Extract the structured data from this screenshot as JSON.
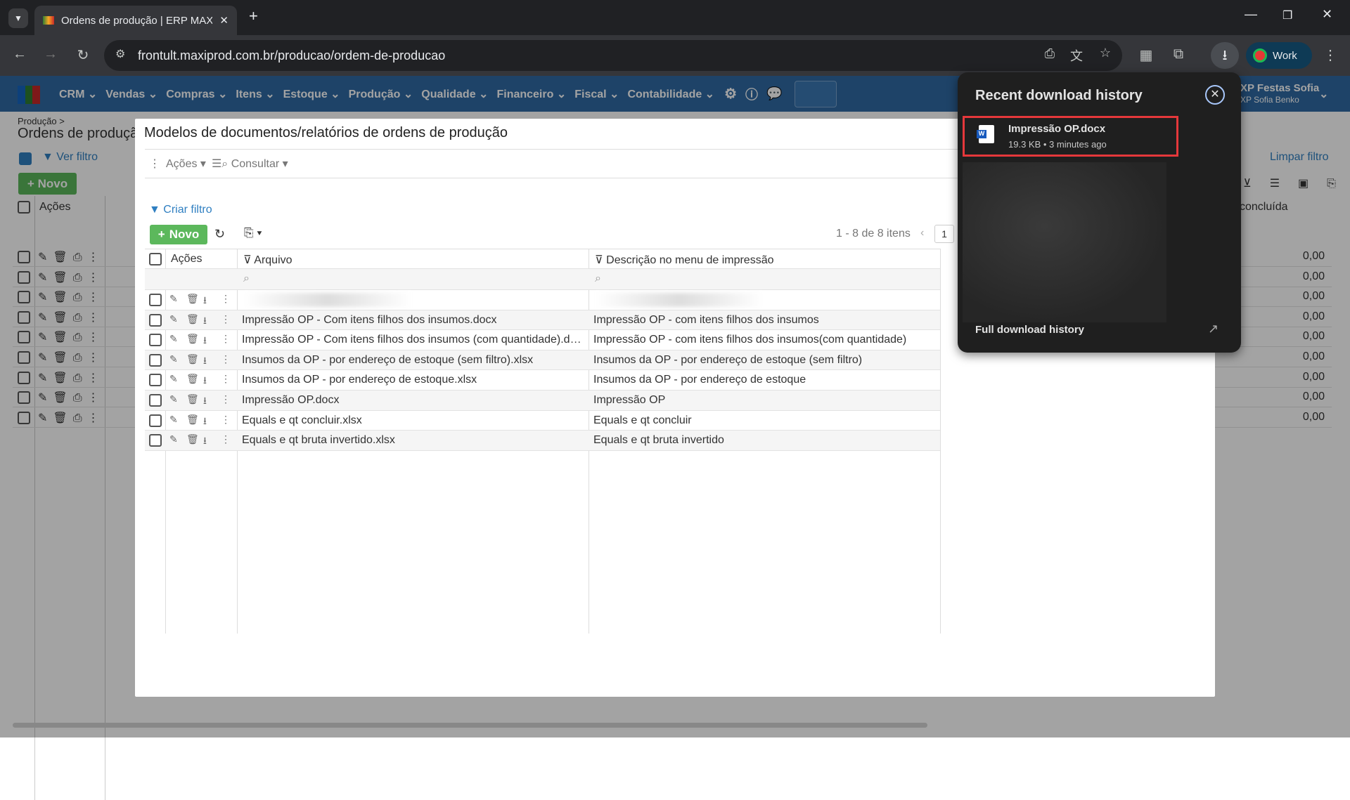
{
  "browser": {
    "tab_title": "Ordens de produção | ERP MAXIPROD",
    "url": "frontult.maxiprod.com.br/producao/ordem-de-producao",
    "profile_label": "Work"
  },
  "app_nav": {
    "menus": [
      "CRM",
      "Vendas",
      "Compras",
      "Itens",
      "Estoque",
      "Produção",
      "Qualidade",
      "Financeiro",
      "Fiscal",
      "Contabilidade"
    ],
    "company": "XP Festas Sofia",
    "user": "XP Sofia Benko"
  },
  "background_page": {
    "breadcrumb": "Produção >",
    "title": "Ordens de produção",
    "filter_link": "Ver filtro",
    "clear_filter": "Limpar filtro",
    "new_label": "Novo",
    "actions_header": "Ações",
    "concluded_header": "concluída",
    "values": [
      "0,00",
      "0,00",
      "0,00",
      "0,00",
      "0,00",
      "0,00",
      "0,00",
      "0,00",
      "0,00"
    ]
  },
  "modal": {
    "title": "Modelos de documentos/relatórios de ordens de produção",
    "actions_menu": "Ações",
    "consult_menu": "Consultar",
    "create_filter": "Criar filtro",
    "new_label": "Novo",
    "pagination_text": "1 - 8 de 8 itens",
    "current_page": "1",
    "columns": {
      "actions": "Ações",
      "file": "Arquivo",
      "description": "Descrição no menu de impressão"
    },
    "rows": [
      {
        "file": "",
        "description": "",
        "blurred": true
      },
      {
        "file": "Impressão OP - Com itens filhos dos insumos.docx",
        "description": "Impressão OP - com itens filhos dos insumos"
      },
      {
        "file": "Impressão OP - Com itens filhos dos insumos (com quantidade).docx",
        "description": "Impressão OP - com itens filhos dos insumos(com quantidade)"
      },
      {
        "file": "Insumos da OP - por endereço de estoque (sem filtro).xlsx",
        "description": "Insumos da OP - por endereço de estoque (sem filtro)"
      },
      {
        "file": "Insumos da OP - por endereço de estoque.xlsx",
        "description": "Insumos da OP - por endereço de estoque"
      },
      {
        "file": "Impressão OP.docx",
        "description": "Impressão OP"
      },
      {
        "file": "Equals e qt concluir.xlsx",
        "description": "Equals e qt concluir"
      },
      {
        "file": "Equals e qt bruta invertido.xlsx",
        "description": "Equals e qt bruta invertido"
      }
    ]
  },
  "downloads_popup": {
    "title": "Recent download history",
    "item_name": "Impressão OP.docx",
    "item_meta": "19.3 KB • 3 minutes ago",
    "full_history": "Full download history"
  },
  "colors": {
    "nav": "#2f6aa3",
    "success": "#5cb85c",
    "link": "#2f7fc1",
    "highlight": "#e5383b"
  }
}
